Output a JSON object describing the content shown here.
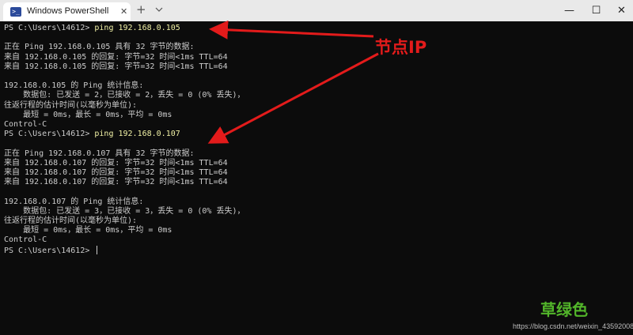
{
  "window": {
    "tab_icon": ">_",
    "tab_title": "Windows PowerShell",
    "tab_close": "✕",
    "new_tab": "+",
    "minimize": "—",
    "maximize": "☐",
    "close": "✕"
  },
  "console": {
    "lines": [
      {
        "prompt": "PS C:\\Users\\14612> ",
        "command": "ping 192.168.0.105"
      },
      {
        "text": ""
      },
      {
        "text": "正在 Ping 192.168.0.105 具有 32 字节的数据:"
      },
      {
        "text": "来自 192.168.0.105 的回复: 字节=32 时间<1ms TTL=64"
      },
      {
        "text": "来自 192.168.0.105 的回复: 字节=32 时间<1ms TTL=64"
      },
      {
        "text": ""
      },
      {
        "text": "192.168.0.105 的 Ping 统计信息:"
      },
      {
        "text": "    数据包: 已发送 = 2，已接收 = 2，丢失 = 0 (0% 丢失)，"
      },
      {
        "text": "往返行程的估计时间(以毫秒为单位):"
      },
      {
        "text": "    最短 = 0ms，最长 = 0ms，平均 = 0ms"
      },
      {
        "text": "Control-C"
      },
      {
        "prompt": "PS C:\\Users\\14612> ",
        "command": "ping 192.168.0.107"
      },
      {
        "text": ""
      },
      {
        "text": "正在 Ping 192.168.0.107 具有 32 字节的数据:"
      },
      {
        "text": "来自 192.168.0.107 的回复: 字节=32 时间<1ms TTL=64"
      },
      {
        "text": "来自 192.168.0.107 的回复: 字节=32 时间<1ms TTL=64"
      },
      {
        "text": "来自 192.168.0.107 的回复: 字节=32 时间<1ms TTL=64"
      },
      {
        "text": ""
      },
      {
        "text": "192.168.0.107 的 Ping 统计信息:"
      },
      {
        "text": "    数据包: 已发送 = 3，已接收 = 3，丢失 = 0 (0% 丢失)，"
      },
      {
        "text": "往返行程的估计时间(以毫秒为单位):"
      },
      {
        "text": "    最短 = 0ms，最长 = 0ms，平均 = 0ms"
      },
      {
        "text": "Control-C"
      },
      {
        "prompt": "PS C:\\Users\\14612> ",
        "command": "",
        "cursor": true
      }
    ]
  },
  "annotation": {
    "label": "节点IP",
    "color": "#e31b1b"
  },
  "watermark": {
    "logo": "草绿色",
    "url": "https://blog.csdn.net/weixin_43592008"
  },
  "colors": {
    "console_bg": "#0c0c0c",
    "console_text": "#cccccc",
    "command_text": "#f1f1a5",
    "titlebar_bg": "#e9e9e9"
  }
}
